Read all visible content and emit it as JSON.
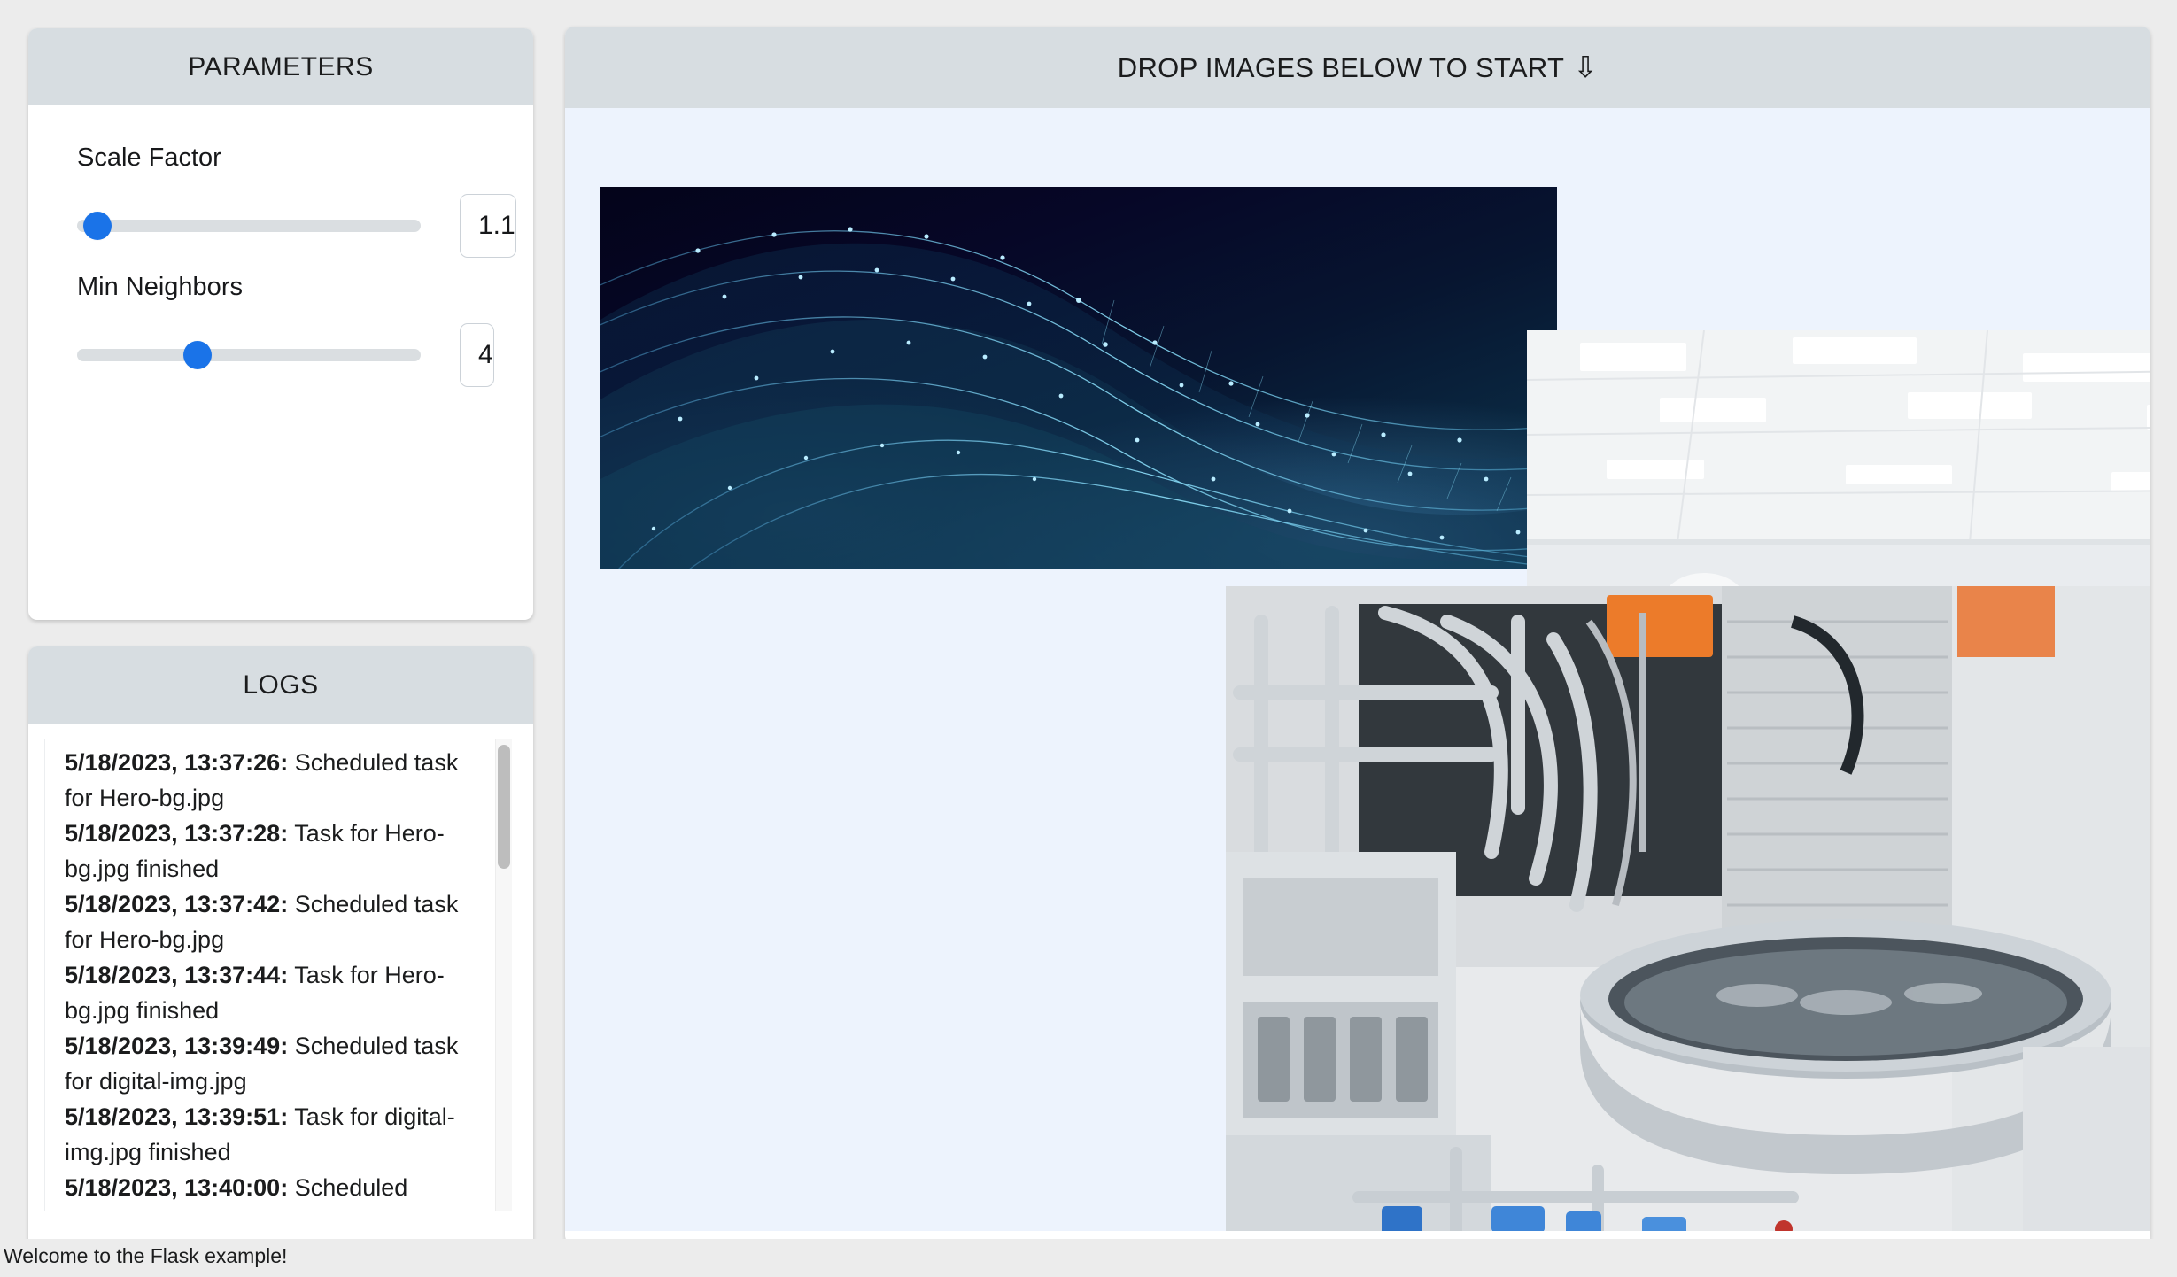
{
  "parameters": {
    "title": "PARAMETERS",
    "controls": [
      {
        "label": "Scale Factor",
        "value": "1.1",
        "slider_percent": 6
      },
      {
        "label": "Min Neighbors",
        "value": "4",
        "slider_percent": 35
      }
    ]
  },
  "logs": {
    "title": "LOGS",
    "entries": [
      {
        "timestamp": "5/18/2023, 13:37:26:",
        "message": "Scheduled task for Hero-bg.jpg"
      },
      {
        "timestamp": "5/18/2023, 13:37:28:",
        "message": "Task for Hero-bg.jpg finished"
      },
      {
        "timestamp": "5/18/2023, 13:37:42:",
        "message": "Scheduled task for Hero-bg.jpg"
      },
      {
        "timestamp": "5/18/2023, 13:37:44:",
        "message": "Task for Hero-bg.jpg finished"
      },
      {
        "timestamp": "5/18/2023, 13:39:49:",
        "message": "Scheduled task for digital-img.jpg"
      },
      {
        "timestamp": "5/18/2023, 13:39:51:",
        "message": "Task for digital-img.jpg finished"
      },
      {
        "timestamp": "5/18/2023, 13:40:00:",
        "message": "Scheduled"
      }
    ]
  },
  "dropzone": {
    "title": "DROP IMAGES BELOW TO START",
    "arrow_icon": "⇩",
    "images": [
      {
        "name": "digital-img.jpg",
        "alt": "abstract dark blue wave network graphic"
      },
      {
        "name": "cleanroom.jpg",
        "alt": "technician in white coverall operating machine in cleanroom"
      },
      {
        "name": "machinery.jpg",
        "alt": "stainless steel industrial processing machinery"
      }
    ]
  },
  "status": {
    "message": "Welcome to the Flask example!"
  },
  "colors": {
    "accent": "#1a73e8",
    "header_bg": "#d7dde1",
    "dropzone_bg": "#edf3fd",
    "page_bg": "#ececec"
  }
}
